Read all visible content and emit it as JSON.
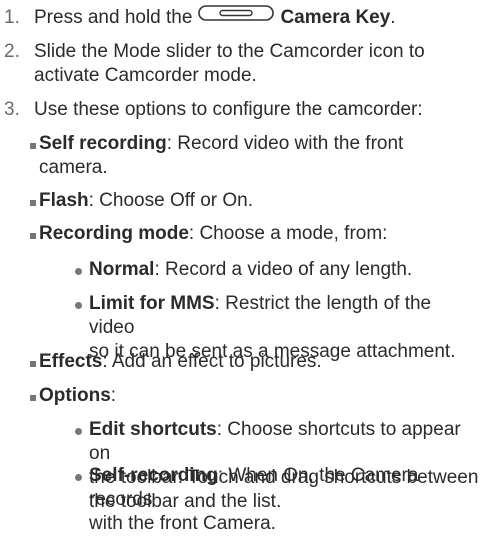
{
  "steps": [
    {
      "number": "1.",
      "prefix": "Press and hold the",
      "key_icon": "camera-key-icon",
      "bold": "Camera Key",
      "suffix": "."
    },
    {
      "number": "2.",
      "line1": "Slide the Mode slider to the Camcorder icon to",
      "line2": "activate Camcorder mode."
    },
    {
      "number": "3.",
      "text": "Use these options to configure the camcorder:"
    }
  ],
  "options": [
    {
      "bold": "Self recording",
      "line1_rest": ": Record video with the front",
      "line2": "camera."
    },
    {
      "bold": "Flash",
      "rest": ": Choose Off or On."
    },
    {
      "bold": "Recording mode",
      "rest": ": Choose a mode, from:",
      "sub": [
        {
          "bold": "Normal",
          "rest": ": Record a video of any length."
        },
        {
          "bold": "Limit for MMS",
          "line1_rest": ": Restrict the length of the video",
          "line2": "so it can be sent as a message attachment."
        }
      ]
    },
    {
      "bold": "Effects",
      "rest": ": Add an effect to pictures."
    },
    {
      "bold": "Options",
      "rest": ":",
      "sub": [
        {
          "bold": "Edit shortcuts",
          "line1_rest": ": Choose shortcuts to appear on",
          "line2": "the toolbar. Touch and drag shortcuts between",
          "line3": "the toolbar and the list."
        },
        {
          "bold": "Self-recording",
          "line1_rest": ": When On, the Camera records",
          "line2": "with the front Camera."
        }
      ]
    }
  ]
}
